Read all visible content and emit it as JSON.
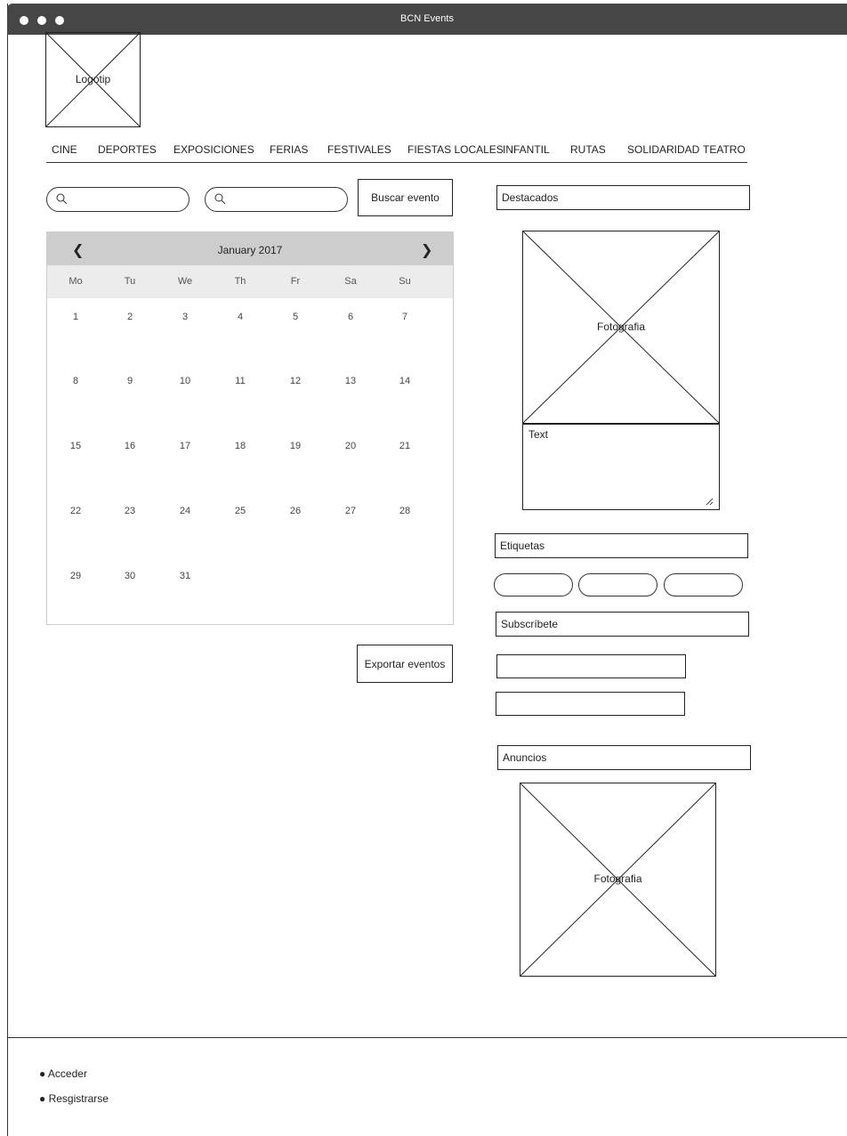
{
  "window": {
    "title": "BCN Events"
  },
  "logo": {
    "label": "Logotip"
  },
  "nav": {
    "items": [
      "CINE",
      "DEPORTES",
      "EXPOSICIONES",
      "FERIAS",
      "FESTIVALES",
      "FIESTAS LOCALES",
      "INFANTIL",
      "RUTAS",
      "SOLIDARIDAD",
      "TEATRO"
    ]
  },
  "search": {
    "field1_value": "",
    "field2_value": "",
    "button_label": "Buscar evento"
  },
  "calendar": {
    "prev_label": "❮",
    "next_label": "❯",
    "month_label": "January 2017",
    "daynames": [
      "Mo",
      "Tu",
      "We",
      "Th",
      "Fr",
      "Sa",
      "Su"
    ],
    "weeks": [
      [
        "1",
        "2",
        "3",
        "4",
        "5",
        "6",
        "7"
      ],
      [
        "8",
        "9",
        "10",
        "11",
        "12",
        "13",
        "14"
      ],
      [
        "15",
        "16",
        "17",
        "18",
        "19",
        "20",
        "21"
      ],
      [
        "22",
        "23",
        "24",
        "25",
        "26",
        "27",
        "28"
      ],
      [
        "29",
        "30",
        "31",
        "",
        "",
        "",
        ""
      ]
    ]
  },
  "export": {
    "button_label": "Exportar eventos"
  },
  "featured": {
    "heading": "Destacados",
    "photo_label": "Fotografia",
    "text_label": "Text"
  },
  "tags": {
    "heading": "Etiquetas"
  },
  "subscribe": {
    "heading": "Subscríbete"
  },
  "ads": {
    "heading": "Anuncios",
    "photo_label": "Fotografia"
  },
  "footer": {
    "items": [
      "Acceder",
      "Resgistrarse"
    ]
  },
  "icons": {
    "search": "search-icon",
    "window_controls": "window-dot-icon",
    "placeholder": "image-placeholder-icon",
    "resize": "resize-grip-icon"
  }
}
